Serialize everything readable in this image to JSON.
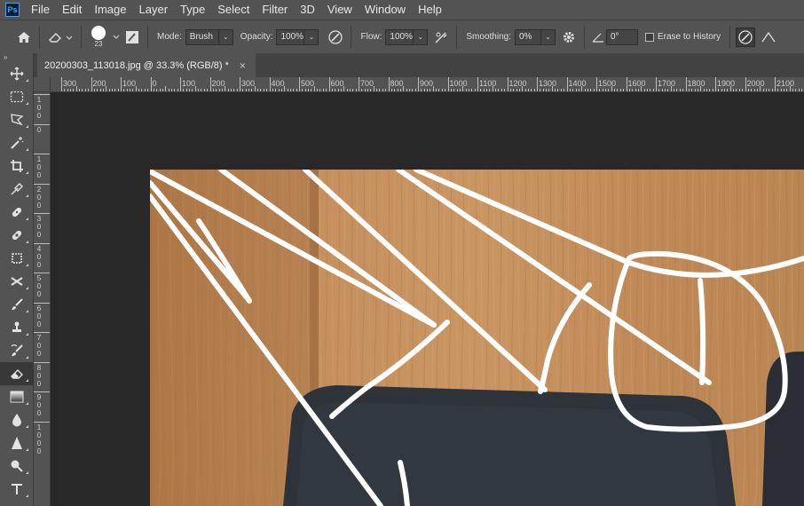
{
  "menubar": {
    "logo": "Ps",
    "items": [
      "File",
      "Edit",
      "Image",
      "Layer",
      "Type",
      "Select",
      "Filter",
      "3D",
      "View",
      "Window",
      "Help"
    ]
  },
  "options": {
    "brush_size": "23",
    "mode_label": "Mode:",
    "mode_value": "Brush",
    "opacity_label": "Opacity:",
    "opacity_value": "100%",
    "flow_label": "Flow:",
    "flow_value": "100%",
    "smoothing_label": "Smoothing:",
    "smoothing_value": "0%",
    "angle_value": "0°",
    "erase_history_label": "Erase to History"
  },
  "document_tab": {
    "title": "20200303_113018.jpg @ 33.3% (RGB/8) *",
    "close": "×"
  },
  "ruler": {
    "h_labels": [
      "300",
      "200",
      "100",
      "0",
      "100",
      "200",
      "300",
      "400",
      "500",
      "600",
      "700",
      "800",
      "900",
      "1000",
      "1100",
      "1200",
      "1300",
      "1400",
      "1500",
      "1600",
      "1700",
      "1800",
      "1900",
      "2000",
      "2100"
    ],
    "v_labels": [
      "100",
      "0",
      "100",
      "200",
      "300",
      "400",
      "500",
      "600",
      "700",
      "800",
      "900",
      "1000"
    ]
  },
  "tools": [
    {
      "name": "move-tool",
      "icon": "move-icon"
    },
    {
      "name": "marquee-tool",
      "icon": "rect-marquee-icon"
    },
    {
      "name": "lasso-tool",
      "icon": "polygon-lasso-icon"
    },
    {
      "name": "magic-wand-tool",
      "icon": "magic-wand-icon"
    },
    {
      "name": "crop-tool",
      "icon": "crop-icon"
    },
    {
      "name": "eyedropper-tool",
      "icon": "eyedropper-icon"
    },
    {
      "name": "healing-brush-tool",
      "icon": "bandage-icon"
    },
    {
      "name": "patch-tool",
      "icon": "bandage-icon"
    },
    {
      "name": "content-aware-tool",
      "icon": "content-aware-icon"
    },
    {
      "name": "red-eye-tool",
      "icon": "cross-icon"
    },
    {
      "name": "brush-tool",
      "icon": "brush-icon"
    },
    {
      "name": "clone-stamp-tool",
      "icon": "stamp-icon"
    },
    {
      "name": "history-brush-tool",
      "icon": "history-brush-icon"
    },
    {
      "name": "eraser-tool",
      "icon": "eraser-icon",
      "active": true
    },
    {
      "name": "gradient-tool",
      "icon": "gradient-icon"
    },
    {
      "name": "blur-tool",
      "icon": "drop-icon"
    },
    {
      "name": "sharpen-tool",
      "icon": "triangle-icon"
    },
    {
      "name": "dodge-tool",
      "icon": "dodge-icon"
    },
    {
      "name": "type-tool",
      "icon": "type-icon"
    }
  ],
  "colors": {
    "ui_dark": "#535353",
    "canvas_bg": "#282828",
    "wood": "#c08a58",
    "bag": "#2f333a",
    "stroke": "#ffffff"
  }
}
